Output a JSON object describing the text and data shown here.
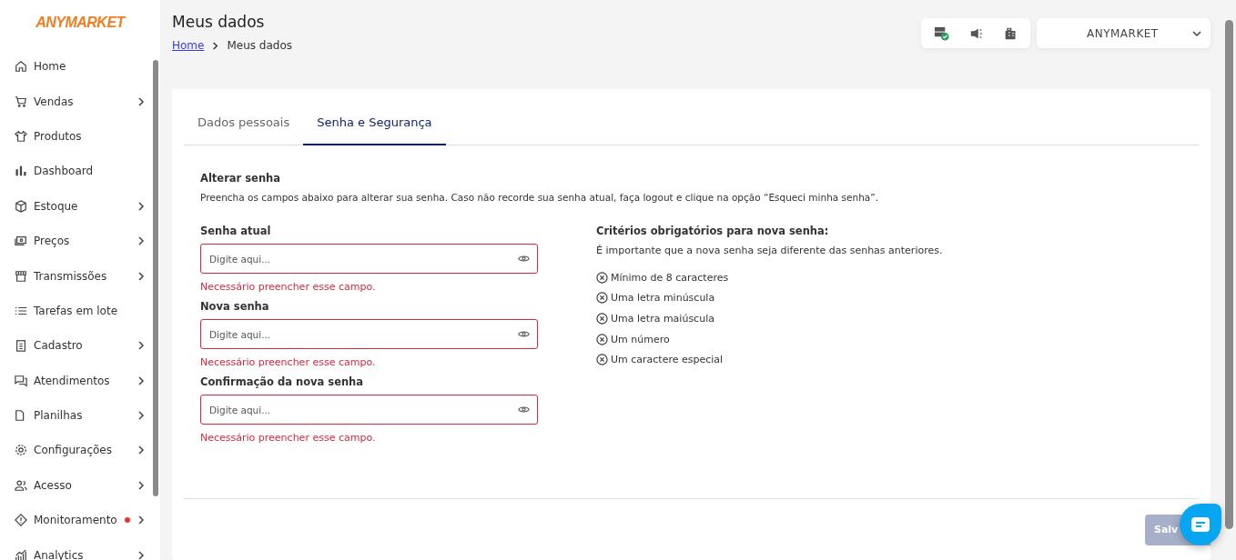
{
  "sidebar": {
    "logo": "ANYMARKET",
    "items": [
      {
        "label": "Home",
        "has_submenu": false,
        "alert": false
      },
      {
        "label": "Vendas",
        "has_submenu": true,
        "alert": false
      },
      {
        "label": "Produtos",
        "has_submenu": false,
        "alert": false
      },
      {
        "label": "Dashboard",
        "has_submenu": false,
        "alert": false
      },
      {
        "label": "Estoque",
        "has_submenu": true,
        "alert": false
      },
      {
        "label": "Preços",
        "has_submenu": true,
        "alert": false
      },
      {
        "label": "Transmissões",
        "has_submenu": true,
        "alert": false
      },
      {
        "label": "Tarefas em lote",
        "has_submenu": false,
        "alert": false
      },
      {
        "label": "Cadastro",
        "has_submenu": true,
        "alert": false
      },
      {
        "label": "Atendimentos",
        "has_submenu": true,
        "alert": false
      },
      {
        "label": "Planilhas",
        "has_submenu": true,
        "alert": false
      },
      {
        "label": "Configurações",
        "has_submenu": true,
        "alert": false
      },
      {
        "label": "Acesso",
        "has_submenu": true,
        "alert": false
      },
      {
        "label": "Monitoramento",
        "has_submenu": true,
        "alert": true
      },
      {
        "label": "Analytics",
        "has_submenu": true,
        "alert": false
      }
    ]
  },
  "header": {
    "title": "Meus dados",
    "breadcrumb": [
      "Home",
      "Meus dados"
    ],
    "account": "ANYMARKET"
  },
  "tabs": [
    {
      "label": "Dados pessoais",
      "selected": false
    },
    {
      "label": "Senha e Segurança",
      "selected": true
    }
  ],
  "section": {
    "title": "Alterar senha",
    "description": "Preencha os campos abaixo para alterar sua senha. Caso não recorde sua senha atual, faça logout e clique na opção “Esqueci minha senha”."
  },
  "fields": [
    {
      "label": "Senha atual",
      "placeholder": "Digite aqui...",
      "invalid": true,
      "error": "Necessário preencher esse campo."
    },
    {
      "label": "Nova senha",
      "placeholder": "Digite aqui...",
      "invalid": true,
      "error": "Necessário preencher esse campo."
    },
    {
      "label": "Confirmação da nova senha",
      "placeholder": "Digite aqui...",
      "invalid": true,
      "error": "Necessário preencher esse campo."
    }
  ],
  "criteria": {
    "title": "Critérios obrigatórios para nova senha:",
    "note": "É importante que a nova senha seja diferente das senhas anteriores.",
    "items": [
      {
        "label": "Mínimo de 8 caracteres",
        "met": false
      },
      {
        "label": "Uma letra minúscula",
        "met": false
      },
      {
        "label": "Uma letra maiúscula",
        "met": false
      },
      {
        "label": "Um número",
        "met": false
      },
      {
        "label": "Um caractere especial",
        "met": false
      }
    ]
  },
  "save_button": {
    "label": "Salv",
    "disabled": true
  }
}
